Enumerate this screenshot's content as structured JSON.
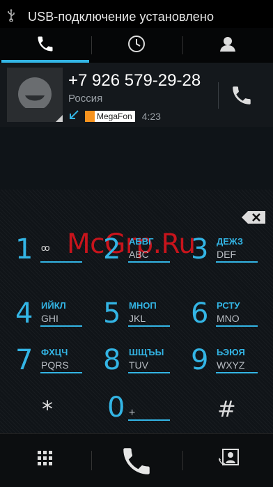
{
  "status_bar": {
    "usb_icon": "usb-icon",
    "text": "USB-подключение установлено"
  },
  "tabs": [
    {
      "name": "phone-icon",
      "selected": true
    },
    {
      "name": "clock-icon",
      "selected": false
    },
    {
      "name": "person-icon",
      "selected": false
    }
  ],
  "recent_call": {
    "number": "+7 926 579-29-28",
    "region": "Россия",
    "call_type_icon": "incoming-call-arrow-icon",
    "carrier": "MegaFon",
    "duration": "4:23"
  },
  "watermark": "McGrp.Ru",
  "keypad": {
    "keys": [
      {
        "digit": "1",
        "top": "",
        "bottom": "oo"
      },
      {
        "digit": "2",
        "top": "АБВГ",
        "bottom": "ABC"
      },
      {
        "digit": "3",
        "top": "ДЕЖЗ",
        "bottom": "DEF"
      },
      {
        "digit": "4",
        "top": "ИЙКЛ",
        "bottom": "GHI"
      },
      {
        "digit": "5",
        "top": "МНОП",
        "bottom": "JKL"
      },
      {
        "digit": "6",
        "top": "РСТУ",
        "bottom": "MNO"
      },
      {
        "digit": "7",
        "top": "ФХЦЧ",
        "bottom": "PQRS"
      },
      {
        "digit": "8",
        "top": "ШЩЪЫ",
        "bottom": "TUV"
      },
      {
        "digit": "9",
        "top": "ЬЭЮЯ",
        "bottom": "WXYZ"
      },
      {
        "digit": "*",
        "top": "",
        "bottom": ""
      },
      {
        "digit": "0",
        "top": "",
        "bottom": "+"
      },
      {
        "digit": "#",
        "top": "",
        "bottom": ""
      }
    ]
  },
  "colors": {
    "accent": "#33b5e5",
    "watermark": "#c8141c"
  }
}
